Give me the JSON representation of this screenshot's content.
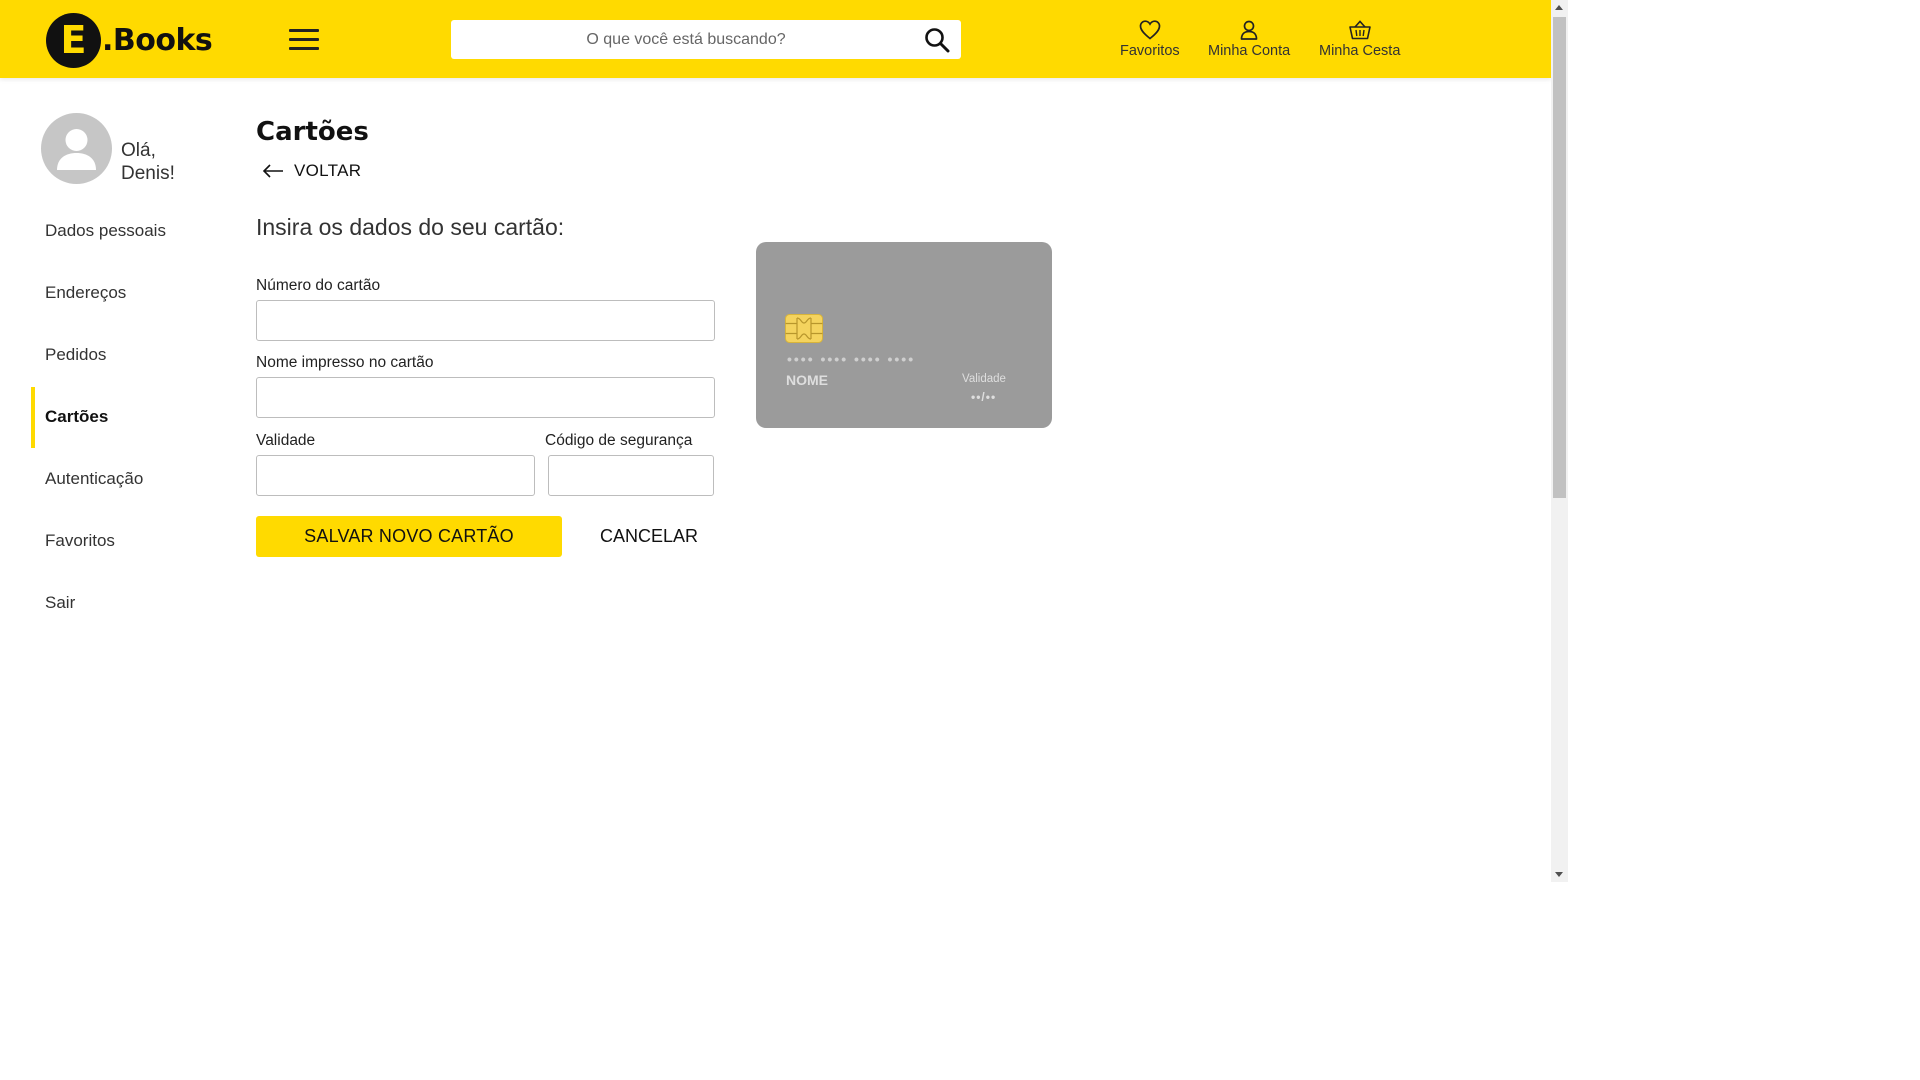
{
  "header": {
    "logo_letter": "E",
    "logo_text": ".Books",
    "search_placeholder": "O que você está buscando?",
    "links": [
      {
        "label": "Favoritos",
        "icon": "heart-icon"
      },
      {
        "label": "Minha Conta",
        "icon": "user-icon"
      },
      {
        "label": "Minha Cesta",
        "icon": "basket-icon"
      }
    ],
    "accent_color": "#FFDA00"
  },
  "sidebar": {
    "greeting_line1": "Olá,",
    "greeting_line2": "Denis!",
    "items": [
      {
        "label": "Dados pessoais",
        "active": false
      },
      {
        "label": "Endereços",
        "active": false
      },
      {
        "label": "Pedidos",
        "active": false
      },
      {
        "label": "Cartões",
        "active": true
      },
      {
        "label": "Autenticação",
        "active": false
      },
      {
        "label": "Favoritos",
        "active": false
      },
      {
        "label": "Sair",
        "active": false
      }
    ]
  },
  "main": {
    "title": "Cartões",
    "back_label": "VOLTAR",
    "subtitle": "Insira os dados do seu cartão:",
    "fields": {
      "card_number": {
        "label": "Número do cartão",
        "value": ""
      },
      "card_name": {
        "label": "Nome impresso no cartão",
        "value": ""
      },
      "expiry": {
        "label": "Validade",
        "value": ""
      },
      "cvv": {
        "label": "Código de segurança",
        "value": ""
      }
    },
    "save_label": "SALVAR NOVO CARTÃO",
    "cancel_label": "CANCELAR"
  },
  "card_preview": {
    "number": "•••• •••• •••• ••••",
    "name": "NOME",
    "validity_label": "Validade",
    "validity_value": "••/••",
    "card_color": "#9B9B9B"
  }
}
